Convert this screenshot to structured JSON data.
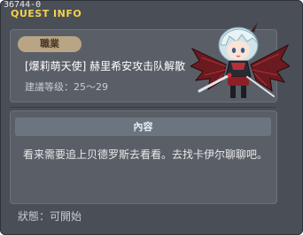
{
  "window": {
    "quest_id": "36744-0",
    "title": "QUEST INFO"
  },
  "info": {
    "job_label": "職業",
    "quest_name": "[爆莉萌天使] 赫里希安攻击队解散",
    "level_label": "建議等级：25～29"
  },
  "description": {
    "header": "內容",
    "text": "看来需要追上贝德罗斯去看看。去找卡伊尔聊聊吧。"
  },
  "status": {
    "text": "狀態：可開始"
  },
  "icons": {
    "character": "angelic-buster-character-icon"
  },
  "colors": {
    "title": "#f2d24a",
    "panel": "#4a4e56",
    "job_tab": "#b9a585"
  }
}
